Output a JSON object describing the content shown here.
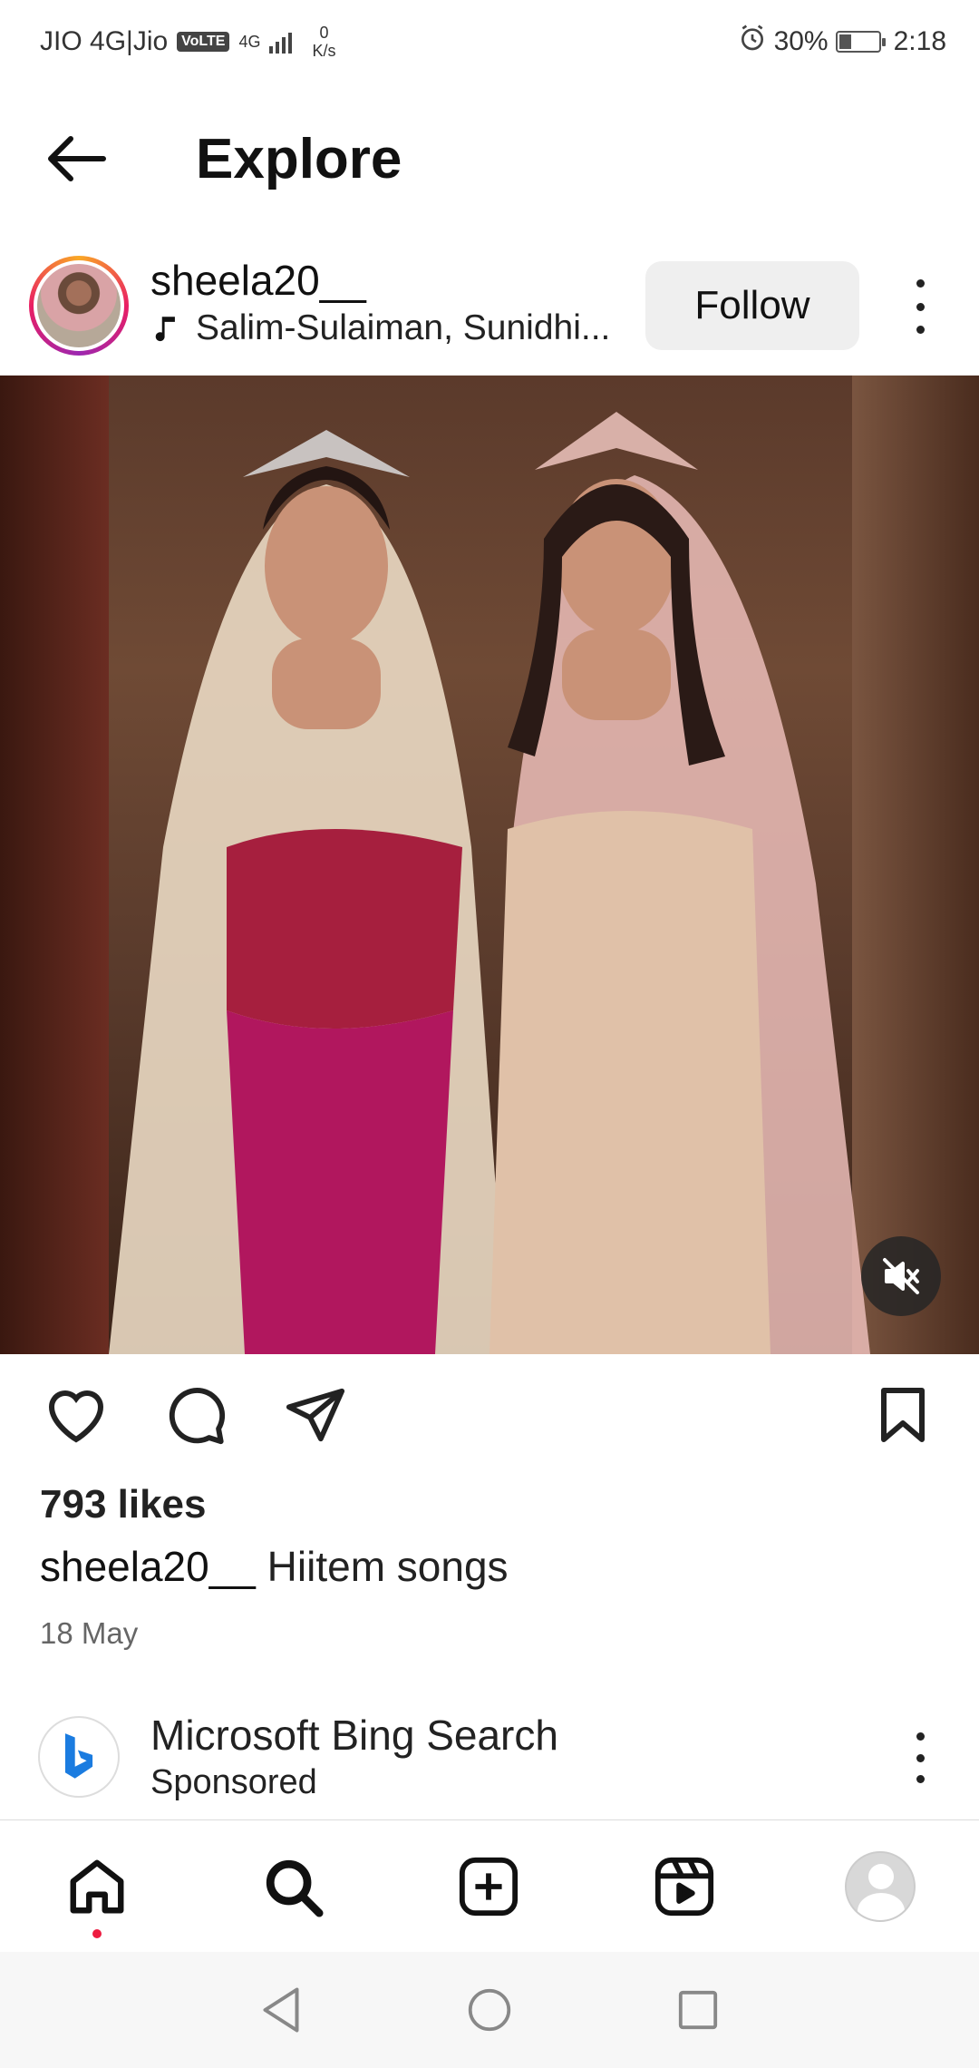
{
  "status_bar": {
    "carrier": "JIO 4G|Jio",
    "volte": "VoLTE",
    "network": "4G",
    "speed_value": "0",
    "speed_unit": "K/s",
    "battery": "30%",
    "time": "2:18",
    "icons": [
      "alarm-icon",
      "battery-charging-icon",
      "signal-icon"
    ]
  },
  "header": {
    "title": "Explore",
    "back_icon": "arrow-left-icon"
  },
  "post": {
    "username": "sheela20__",
    "audio": "Salim-Sulaiman, Sunidhi...",
    "follow_label": "Follow",
    "image_desc_icon": "mute-icon",
    "likes": "793 likes",
    "caption_user": "sheela20__",
    "caption_text": "Hiitem songs",
    "date": "18 May",
    "actions": [
      "heart-icon",
      "comment-icon",
      "share-icon",
      "bookmark-icon"
    ]
  },
  "sponsored": {
    "title": "Microsoft Bing Search",
    "subtitle": "Sponsored"
  },
  "bottom_nav": [
    "home-icon",
    "search-icon",
    "create-icon",
    "reels-icon",
    "profile-avatar"
  ],
  "system_nav": [
    "back-triangle-icon",
    "home-circle-icon",
    "recents-square-icon"
  ],
  "colors": {
    "accent_red": "#ed1c40",
    "follow_bg": "#efefef",
    "text_primary": "#111111",
    "text_secondary": "#666666"
  }
}
